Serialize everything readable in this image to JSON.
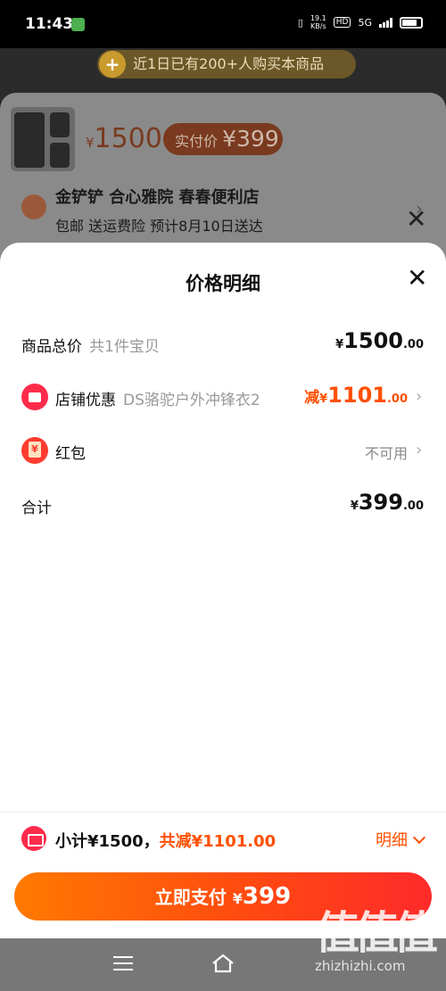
{
  "status": {
    "time": "11:43",
    "net_speed_value": "19.1",
    "net_speed_unit": "KB/s",
    "hd": "HD",
    "network": "5G"
  },
  "toast": {
    "text": "近1日已有200+人购买本商品"
  },
  "product": {
    "currency": "¥",
    "original_price": "1500",
    "pay_label": "实付价",
    "pay_price": "¥399"
  },
  "address": {
    "name": "金铲铲 合心雅院 春春便利店",
    "sub": "包邮 送运费险 预计8月10日送达"
  },
  "price_detail": {
    "title": "价格明细",
    "rows": {
      "total": {
        "label": "商品总价",
        "sub": "共1件宝贝",
        "currency": "¥",
        "int": "1500",
        "dec": ".00"
      },
      "shop_discount": {
        "label": "店铺优惠",
        "sub": "DS骆驼户外冲锋衣2",
        "prefix": "减",
        "currency": "¥",
        "int": "1101",
        "dec": ".00"
      },
      "red_packet": {
        "label": "红包",
        "value": "不可用"
      },
      "sum": {
        "label": "合计",
        "currency": "¥",
        "int": "399",
        "dec": ".00"
      }
    }
  },
  "bottom": {
    "subtotal": "小计¥1500，",
    "discount": "共减¥1101.00",
    "detail_link": "明细",
    "pay_button_label": "立即支付",
    "pay_button_currency": "¥",
    "pay_button_amount": "399"
  },
  "watermark": {
    "big": "值值值",
    "small": "zhizhizhi.com"
  },
  "colors": {
    "accent": "#ff5000",
    "pay_gradient_start": "#ff7a00",
    "pay_gradient_end": "#ff2a2a"
  }
}
